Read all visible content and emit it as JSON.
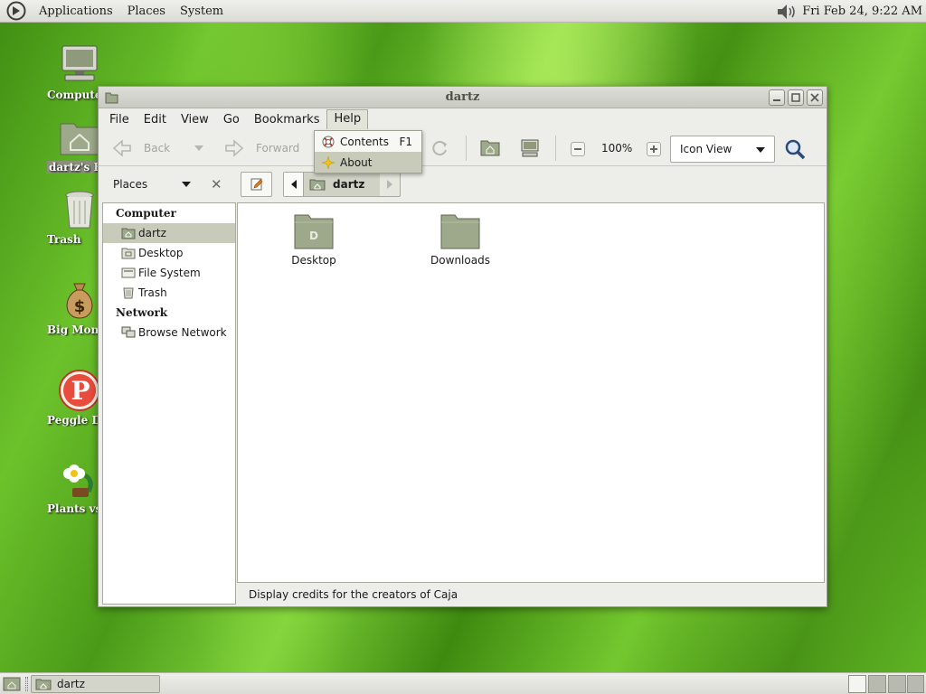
{
  "top_panel": {
    "menus": [
      "Applications",
      "Places",
      "System"
    ],
    "clock": "Fri Feb 24,  9:22 AM"
  },
  "desktop": {
    "icons": [
      {
        "label": "Computer",
        "icon": "computer-icon"
      },
      {
        "label": "dartz's Home",
        "icon": "home-folder-icon"
      },
      {
        "label": "Trash",
        "icon": "trash-icon"
      },
      {
        "label": "Big Money Deluxe",
        "icon": "money-bag-icon"
      },
      {
        "label": "Peggle Deluxe",
        "icon": "peggle-icon"
      },
      {
        "label": "Plants vs Zombies",
        "icon": "plants-icon"
      }
    ]
  },
  "window": {
    "title": "dartz",
    "menubar": [
      "File",
      "Edit",
      "View",
      "Go",
      "Bookmarks",
      "Help"
    ],
    "toolbar": {
      "back": "Back",
      "forward": "Forward",
      "zoom": "100%",
      "view_mode": "Icon View"
    },
    "sidepane": {
      "header": "Places",
      "sections": [
        {
          "title": "Computer",
          "items": [
            "dartz",
            "Desktop",
            "File System",
            "Trash"
          ]
        },
        {
          "title": "Network",
          "items": [
            "Browse Network"
          ]
        }
      ]
    },
    "location": {
      "current": "dartz"
    },
    "files": [
      {
        "name": "Desktop"
      },
      {
        "name": "Downloads"
      }
    ],
    "status": "Display credits for the creators of Caja"
  },
  "help_menu": {
    "contents_label": "Contents",
    "contents_accel": "F1",
    "about_label": "About"
  },
  "bottom_panel": {
    "task_label": "dartz"
  }
}
